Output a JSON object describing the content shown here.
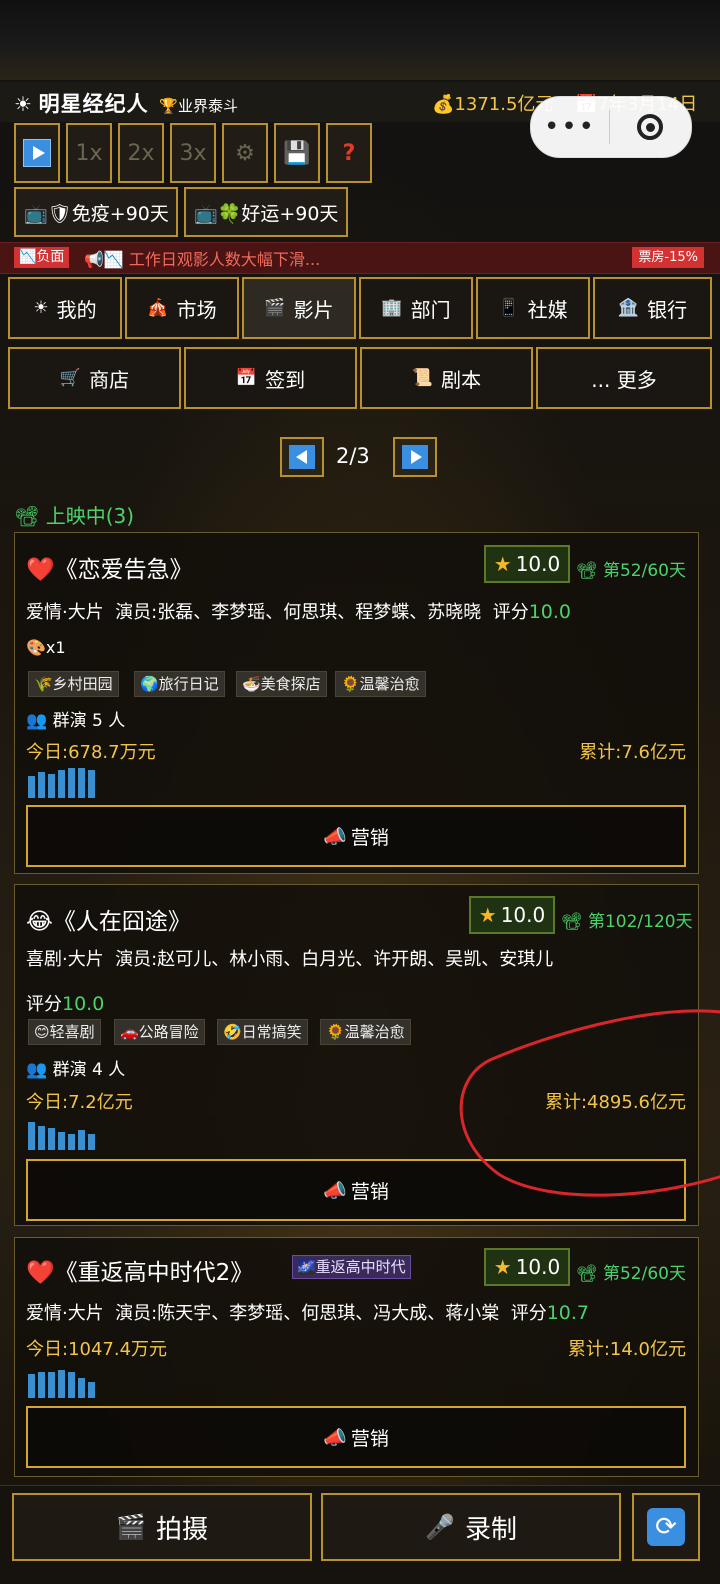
{
  "app": {
    "icon": "sun-icon",
    "title": "明星经纪人",
    "rank_icon": "trophy-icon",
    "rank": "业界泰斗",
    "money": "💰1371.5亿元",
    "date": "📅7年3月14日"
  },
  "controls": {
    "play": "play-icon",
    "speed1": "1x",
    "speed2": "2x",
    "speed3": "3x",
    "settings": "⚙",
    "save": "💾",
    "help": "?"
  },
  "buffs": [
    {
      "label": "📺🛡免疫+90天"
    },
    {
      "label": "📺🍀好运+90天"
    }
  ],
  "ticker": {
    "badge": "📉负面",
    "text": "📢📉 工作日观影人数大幅下滑...",
    "effect": "票房-15%"
  },
  "nav_row1": [
    {
      "icon": "☀",
      "label": "我的"
    },
    {
      "icon": "🎪",
      "label": "市场"
    },
    {
      "icon": "🎬",
      "label": "影片"
    },
    {
      "icon": "🏢",
      "label": "部门"
    },
    {
      "icon": "📱",
      "label": "社媒"
    },
    {
      "icon": "🏦",
      "label": "银行"
    }
  ],
  "nav_row2": [
    {
      "icon": "🛒",
      "label": "商店"
    },
    {
      "icon": "📅",
      "label": "签到"
    },
    {
      "icon": "📜",
      "label": "剧本"
    },
    {
      "icon": "",
      "label": "... 更多"
    }
  ],
  "pager": {
    "text": "2/3"
  },
  "section": {
    "title": "📽 上映中(3)"
  },
  "movies": [
    {
      "emoji": "❤️",
      "title": "《恋爱告急》",
      "rating": "10.0",
      "day": "📽 第52/60天",
      "genre": "爱情·大片",
      "cast": "演员:张磊、李梦瑶、何思琪、程梦蝶、苏晓晓",
      "score_label": "评分",
      "score": "10.0",
      "extra": "🎨x1",
      "tags": [
        "🌾乡村田园",
        "🌍旅行日记",
        "🍜美食探店",
        "🌻温馨治愈"
      ],
      "extras": "👥 群演 5 人",
      "today": "今日:678.7万元",
      "total": "累计:7.6亿元",
      "bars": [
        22,
        26,
        24,
        28,
        30,
        30,
        28
      ],
      "market": "营销"
    },
    {
      "emoji": "😂",
      "title": "《人在囧途》",
      "rating": "10.0",
      "day": "📽 第102/120天",
      "genre": "喜剧·大片",
      "cast": "演员:赵可儿、林小雨、白月光、许开朗、吴凯、安琪儿",
      "score_label": "评分",
      "score": "10.0",
      "tags": [
        "😊轻喜剧",
        "🚗公路冒险",
        "🤣日常搞笑",
        "🌻温馨治愈"
      ],
      "extras": "👥 群演 4 人",
      "today": "今日:7.2亿元",
      "total": "累计:4895.6亿元",
      "bars": [
        28,
        24,
        22,
        18,
        16,
        20,
        16
      ],
      "market": "营销"
    },
    {
      "emoji": "❤️",
      "title": "《重返高中时代2》",
      "series": "🌌重返高中时代",
      "rating": "10.0",
      "day": "📽 第52/60天",
      "genre": "爱情·大片",
      "cast": "演员:陈天宇、李梦瑶、何思琪、冯大成、蒋小棠",
      "score_label": "评分",
      "score": "10.7",
      "today": "今日:1047.4万元",
      "total": "累计:14.0亿元",
      "bars": [
        24,
        26,
        26,
        28,
        26,
        20,
        16
      ],
      "market": "营销"
    }
  ],
  "bottom": {
    "shoot": "拍摄",
    "shoot_icon": "🎬",
    "record": "录制",
    "record_icon": "🎤",
    "refresh_icon": "refresh-icon"
  },
  "colors": {
    "accent_gold": "#b8902e",
    "green": "#4bd36b",
    "blue": "#3a8fe0",
    "negative": "#d23232"
  }
}
